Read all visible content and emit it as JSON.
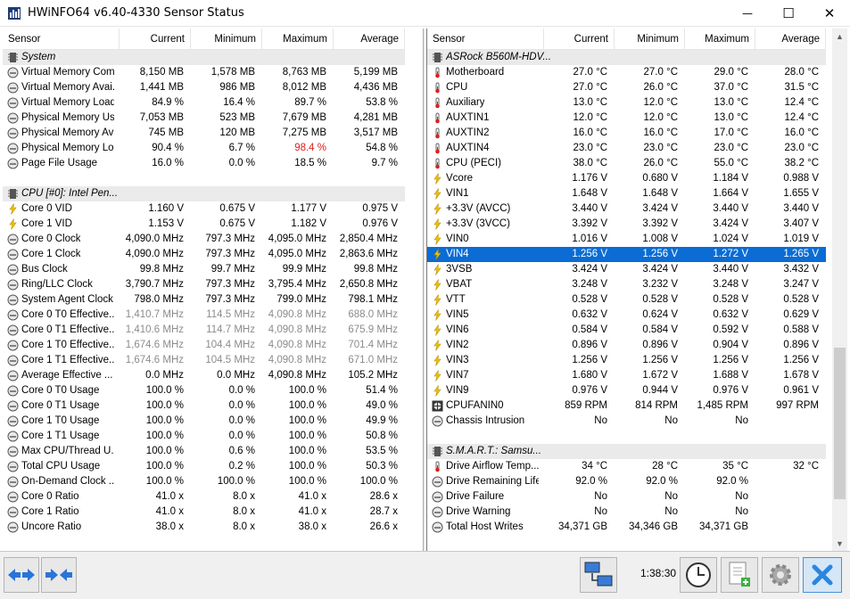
{
  "window": {
    "title": "HWiNFO64 v6.40-4330 Sensor Status",
    "min_glyph": "—",
    "max_glyph": "☐",
    "close_glyph": "✕"
  },
  "columns": {
    "sensor": "Sensor",
    "current": "Current",
    "minimum": "Minimum",
    "maximum": "Maximum",
    "average": "Average"
  },
  "left_rows": [
    {
      "kind": "group",
      "icon": "chip-icon",
      "name": "System"
    },
    {
      "icon": "gauge-icon",
      "name": "Virtual Memory Com...",
      "cur": "8,150 MB",
      "min": "1,578 MB",
      "max": "8,763 MB",
      "avg": "5,199 MB"
    },
    {
      "icon": "gauge-icon",
      "name": "Virtual Memory Avai...",
      "cur": "1,441 MB",
      "min": "986 MB",
      "max": "8,012 MB",
      "avg": "4,436 MB"
    },
    {
      "icon": "gauge-icon",
      "name": "Virtual Memory Load",
      "cur": "84.9 %",
      "min": "16.4 %",
      "max": "89.7 %",
      "avg": "53.8 %"
    },
    {
      "icon": "gauge-icon",
      "name": "Physical Memory Used",
      "cur": "7,053 MB",
      "min": "523 MB",
      "max": "7,679 MB",
      "avg": "4,281 MB"
    },
    {
      "icon": "gauge-icon",
      "name": "Physical Memory Avai...",
      "cur": "745 MB",
      "min": "120 MB",
      "max": "7,275 MB",
      "avg": "3,517 MB"
    },
    {
      "icon": "gauge-icon",
      "name": "Physical Memory Load",
      "cur": "90.4 %",
      "min": "6.7 %",
      "max": "98.4 %",
      "avg": "54.8 %",
      "max_red": true
    },
    {
      "icon": "gauge-icon",
      "name": "Page File Usage",
      "cur": "16.0 %",
      "min": "0.0 %",
      "max": "18.5 %",
      "avg": "9.7 %"
    },
    {
      "kind": "blank"
    },
    {
      "kind": "group",
      "icon": "chip-icon",
      "name": "CPU [#0]: Intel Pen..."
    },
    {
      "icon": "bolt-icon",
      "name": "Core 0 VID",
      "cur": "1.160 V",
      "min": "0.675 V",
      "max": "1.177 V",
      "avg": "0.975 V"
    },
    {
      "icon": "bolt-icon",
      "name": "Core 1 VID",
      "cur": "1.153 V",
      "min": "0.675 V",
      "max": "1.182 V",
      "avg": "0.976 V"
    },
    {
      "icon": "gauge-icon",
      "name": "Core 0 Clock",
      "cur": "4,090.0 MHz",
      "min": "797.3 MHz",
      "max": "4,095.0 MHz",
      "avg": "2,850.4 MHz"
    },
    {
      "icon": "gauge-icon",
      "name": "Core 1 Clock",
      "cur": "4,090.0 MHz",
      "min": "797.3 MHz",
      "max": "4,095.0 MHz",
      "avg": "2,863.6 MHz"
    },
    {
      "icon": "gauge-icon",
      "name": "Bus Clock",
      "cur": "99.8 MHz",
      "min": "99.7 MHz",
      "max": "99.9 MHz",
      "avg": "99.8 MHz"
    },
    {
      "icon": "gauge-icon",
      "name": "Ring/LLC Clock",
      "cur": "3,790.7 MHz",
      "min": "797.3 MHz",
      "max": "3,795.4 MHz",
      "avg": "2,650.8 MHz"
    },
    {
      "icon": "gauge-icon",
      "name": "System Agent Clock",
      "cur": "798.0 MHz",
      "min": "797.3 MHz",
      "max": "799.0 MHz",
      "avg": "798.1 MHz"
    },
    {
      "icon": "gauge-icon",
      "name": "Core 0 T0 Effective...",
      "cur": "1,410.7 MHz",
      "min": "114.5 MHz",
      "max": "4,090.8 MHz",
      "avg": "688.0 MHz",
      "gray": true
    },
    {
      "icon": "gauge-icon",
      "name": "Core 0 T1 Effective...",
      "cur": "1,410.6 MHz",
      "min": "114.7 MHz",
      "max": "4,090.8 MHz",
      "avg": "675.9 MHz",
      "gray": true
    },
    {
      "icon": "gauge-icon",
      "name": "Core 1 T0 Effective...",
      "cur": "1,674.6 MHz",
      "min": "104.4 MHz",
      "max": "4,090.8 MHz",
      "avg": "701.4 MHz",
      "gray": true
    },
    {
      "icon": "gauge-icon",
      "name": "Core 1 T1 Effective...",
      "cur": "1,674.6 MHz",
      "min": "104.5 MHz",
      "max": "4,090.8 MHz",
      "avg": "671.0 MHz",
      "gray": true
    },
    {
      "icon": "gauge-icon",
      "name": "Average Effective ...",
      "cur": "0.0 MHz",
      "min": "0.0 MHz",
      "max": "4,090.8 MHz",
      "avg": "105.2 MHz"
    },
    {
      "icon": "gauge-icon",
      "name": "Core 0 T0 Usage",
      "cur": "100.0 %",
      "min": "0.0 %",
      "max": "100.0 %",
      "avg": "51.4 %"
    },
    {
      "icon": "gauge-icon",
      "name": "Core 0 T1 Usage",
      "cur": "100.0 %",
      "min": "0.0 %",
      "max": "100.0 %",
      "avg": "49.0 %"
    },
    {
      "icon": "gauge-icon",
      "name": "Core 1 T0 Usage",
      "cur": "100.0 %",
      "min": "0.0 %",
      "max": "100.0 %",
      "avg": "49.9 %"
    },
    {
      "icon": "gauge-icon",
      "name": "Core 1 T1 Usage",
      "cur": "100.0 %",
      "min": "0.0 %",
      "max": "100.0 %",
      "avg": "50.8 %"
    },
    {
      "icon": "gauge-icon",
      "name": "Max CPU/Thread U...",
      "cur": "100.0 %",
      "min": "0.6 %",
      "max": "100.0 %",
      "avg": "53.5 %"
    },
    {
      "icon": "gauge-icon",
      "name": "Total CPU Usage",
      "cur": "100.0 %",
      "min": "0.2 %",
      "max": "100.0 %",
      "avg": "50.3 %"
    },
    {
      "icon": "gauge-icon",
      "name": "On-Demand Clock ...",
      "cur": "100.0 %",
      "min": "100.0 %",
      "max": "100.0 %",
      "avg": "100.0 %"
    },
    {
      "icon": "gauge-icon",
      "name": "Core 0 Ratio",
      "cur": "41.0 x",
      "min": "8.0 x",
      "max": "41.0 x",
      "avg": "28.6 x"
    },
    {
      "icon": "gauge-icon",
      "name": "Core 1 Ratio",
      "cur": "41.0 x",
      "min": "8.0 x",
      "max": "41.0 x",
      "avg": "28.7 x"
    },
    {
      "icon": "gauge-icon",
      "name": "Uncore Ratio",
      "cur": "38.0 x",
      "min": "8.0 x",
      "max": "38.0 x",
      "avg": "26.6 x"
    }
  ],
  "right_rows": [
    {
      "kind": "group",
      "icon": "chip-icon",
      "name": "ASRock B560M-HDV..."
    },
    {
      "icon": "thermometer-icon",
      "name": "Motherboard",
      "cur": "27.0 °C",
      "min": "27.0 °C",
      "max": "29.0 °C",
      "avg": "28.0 °C"
    },
    {
      "icon": "thermometer-icon",
      "name": "CPU",
      "cur": "27.0 °C",
      "min": "26.0 °C",
      "max": "37.0 °C",
      "avg": "31.5 °C"
    },
    {
      "icon": "thermometer-icon",
      "name": "Auxiliary",
      "cur": "13.0 °C",
      "min": "12.0 °C",
      "max": "13.0 °C",
      "avg": "12.4 °C"
    },
    {
      "icon": "thermometer-icon",
      "name": "AUXTIN1",
      "cur": "12.0 °C",
      "min": "12.0 °C",
      "max": "13.0 °C",
      "avg": "12.4 °C"
    },
    {
      "icon": "thermometer-icon",
      "name": "AUXTIN2",
      "cur": "16.0 °C",
      "min": "16.0 °C",
      "max": "17.0 °C",
      "avg": "16.0 °C"
    },
    {
      "icon": "thermometer-icon",
      "name": "AUXTIN4",
      "cur": "23.0 °C",
      "min": "23.0 °C",
      "max": "23.0 °C",
      "avg": "23.0 °C"
    },
    {
      "icon": "thermometer-icon",
      "name": "CPU (PECI)",
      "cur": "38.0 °C",
      "min": "26.0 °C",
      "max": "55.0 °C",
      "avg": "38.2 °C"
    },
    {
      "icon": "bolt-icon",
      "name": "Vcore",
      "cur": "1.176 V",
      "min": "0.680 V",
      "max": "1.184 V",
      "avg": "0.988 V"
    },
    {
      "icon": "bolt-icon",
      "name": "VIN1",
      "cur": "1.648 V",
      "min": "1.648 V",
      "max": "1.664 V",
      "avg": "1.655 V"
    },
    {
      "icon": "bolt-icon",
      "name": "+3.3V (AVCC)",
      "cur": "3.440 V",
      "min": "3.424 V",
      "max": "3.440 V",
      "avg": "3.440 V"
    },
    {
      "icon": "bolt-icon",
      "name": "+3.3V (3VCC)",
      "cur": "3.392 V",
      "min": "3.392 V",
      "max": "3.424 V",
      "avg": "3.407 V"
    },
    {
      "icon": "bolt-icon",
      "name": "VIN0",
      "cur": "1.016 V",
      "min": "1.008 V",
      "max": "1.024 V",
      "avg": "1.019 V"
    },
    {
      "icon": "bolt-icon",
      "name": "VIN4",
      "cur": "1.256 V",
      "min": "1.256 V",
      "max": "1.272 V",
      "avg": "1.265 V",
      "selected": true
    },
    {
      "icon": "bolt-icon",
      "name": "3VSB",
      "cur": "3.424 V",
      "min": "3.424 V",
      "max": "3.440 V",
      "avg": "3.432 V"
    },
    {
      "icon": "bolt-icon",
      "name": "VBAT",
      "cur": "3.248 V",
      "min": "3.232 V",
      "max": "3.248 V",
      "avg": "3.247 V"
    },
    {
      "icon": "bolt-icon",
      "name": "VTT",
      "cur": "0.528 V",
      "min": "0.528 V",
      "max": "0.528 V",
      "avg": "0.528 V"
    },
    {
      "icon": "bolt-icon",
      "name": "VIN5",
      "cur": "0.632 V",
      "min": "0.624 V",
      "max": "0.632 V",
      "avg": "0.629 V"
    },
    {
      "icon": "bolt-icon",
      "name": "VIN6",
      "cur": "0.584 V",
      "min": "0.584 V",
      "max": "0.592 V",
      "avg": "0.588 V"
    },
    {
      "icon": "bolt-icon",
      "name": "VIN2",
      "cur": "0.896 V",
      "min": "0.896 V",
      "max": "0.904 V",
      "avg": "0.896 V"
    },
    {
      "icon": "bolt-icon",
      "name": "VIN3",
      "cur": "1.256 V",
      "min": "1.256 V",
      "max": "1.256 V",
      "avg": "1.256 V"
    },
    {
      "icon": "bolt-icon",
      "name": "VIN7",
      "cur": "1.680 V",
      "min": "1.672 V",
      "max": "1.688 V",
      "avg": "1.678 V"
    },
    {
      "icon": "bolt-icon",
      "name": "VIN9",
      "cur": "0.976 V",
      "min": "0.944 V",
      "max": "0.976 V",
      "avg": "0.961 V"
    },
    {
      "icon": "fan-icon",
      "name": "CPUFANIN0",
      "cur": "859 RPM",
      "min": "814 RPM",
      "max": "1,485 RPM",
      "avg": "997 RPM"
    },
    {
      "icon": "gauge-icon",
      "name": "Chassis Intrusion",
      "cur": "No",
      "min": "No",
      "max": "No",
      "avg": ""
    },
    {
      "kind": "blank"
    },
    {
      "kind": "group",
      "icon": "chip-icon",
      "name": "S.M.A.R.T.: Samsu..."
    },
    {
      "icon": "thermometer-icon",
      "name": "Drive Airflow Temp...",
      "cur": "34 °C",
      "min": "28 °C",
      "max": "35 °C",
      "avg": "32 °C"
    },
    {
      "icon": "gauge-icon",
      "name": "Drive Remaining Life",
      "cur": "92.0 %",
      "min": "92.0 %",
      "max": "92.0 %",
      "avg": ""
    },
    {
      "icon": "gauge-icon",
      "name": "Drive Failure",
      "cur": "No",
      "min": "No",
      "max": "No",
      "avg": ""
    },
    {
      "icon": "gauge-icon",
      "name": "Drive Warning",
      "cur": "No",
      "min": "No",
      "max": "No",
      "avg": ""
    },
    {
      "icon": "gauge-icon",
      "name": "Total Host Writes",
      "cur": "34,371 GB",
      "min": "34,346 GB",
      "max": "34,371 GB",
      "avg": ""
    }
  ],
  "bottom": {
    "elapsed": "1:38:30"
  },
  "colors": {
    "selection": "#0a6cd4",
    "alarm_red": "#e0201c",
    "group_bg": "#eaeaea",
    "toolbar_bg": "#f0f0f0"
  }
}
